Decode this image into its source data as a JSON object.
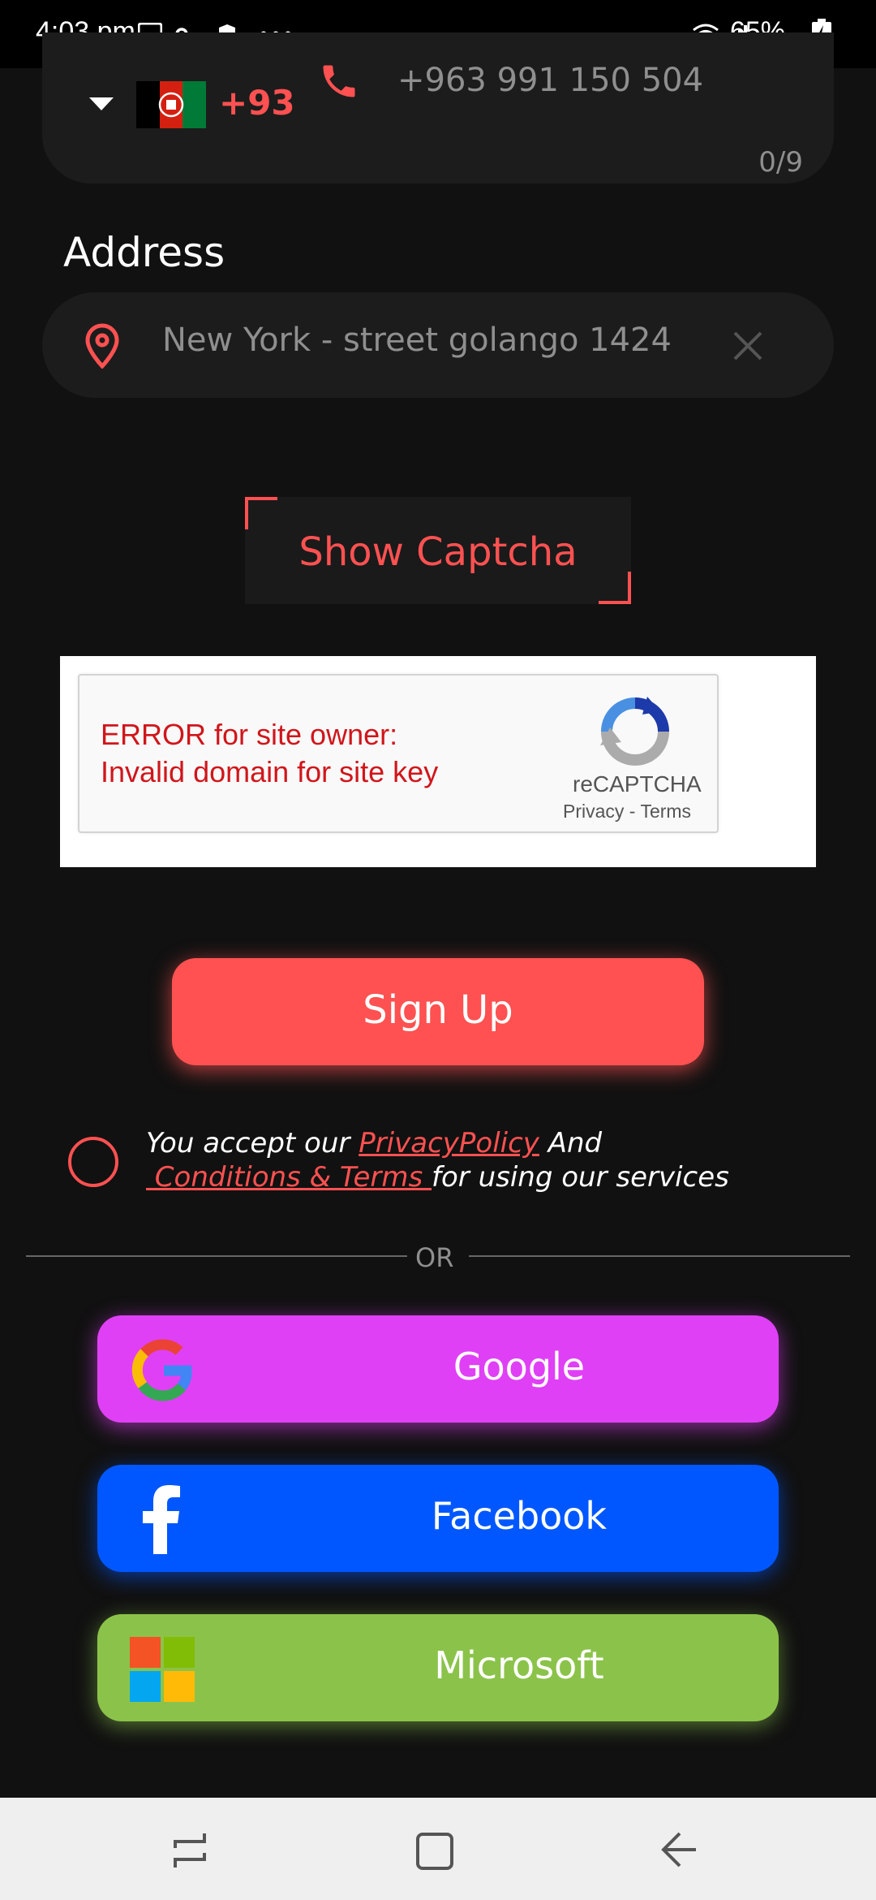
{
  "status_bar": {
    "time": "4:03 pm",
    "battery": "65%"
  },
  "phone": {
    "country_code": "+93",
    "value": "+963 991 150 504",
    "char_count": "0/9"
  },
  "address": {
    "label": "Address",
    "value": "New York - street golango 1424"
  },
  "captcha_button": {
    "label": "Show Captcha"
  },
  "recaptcha": {
    "error_line1": "ERROR for site owner:",
    "error_line2": "Invalid domain for site key",
    "brand": "reCAPTCHA",
    "privacy": "Privacy",
    "separator": " - ",
    "terms": "Terms"
  },
  "signup": {
    "label": "Sign Up"
  },
  "terms": {
    "prefix": "You accept our ",
    "privacy_link": "PrivacyPolicy",
    "and": " And",
    "conditions_link": " Conditions & Terms ",
    "suffix": "for using our services"
  },
  "divider": {
    "text": "OR"
  },
  "social": {
    "google": "Google",
    "facebook": "Facebook",
    "microsoft": "Microsoft"
  },
  "colors": {
    "accent": "#ff5151",
    "google": "#e040f5",
    "facebook": "#0057ff",
    "microsoft": "#8bc34a"
  }
}
